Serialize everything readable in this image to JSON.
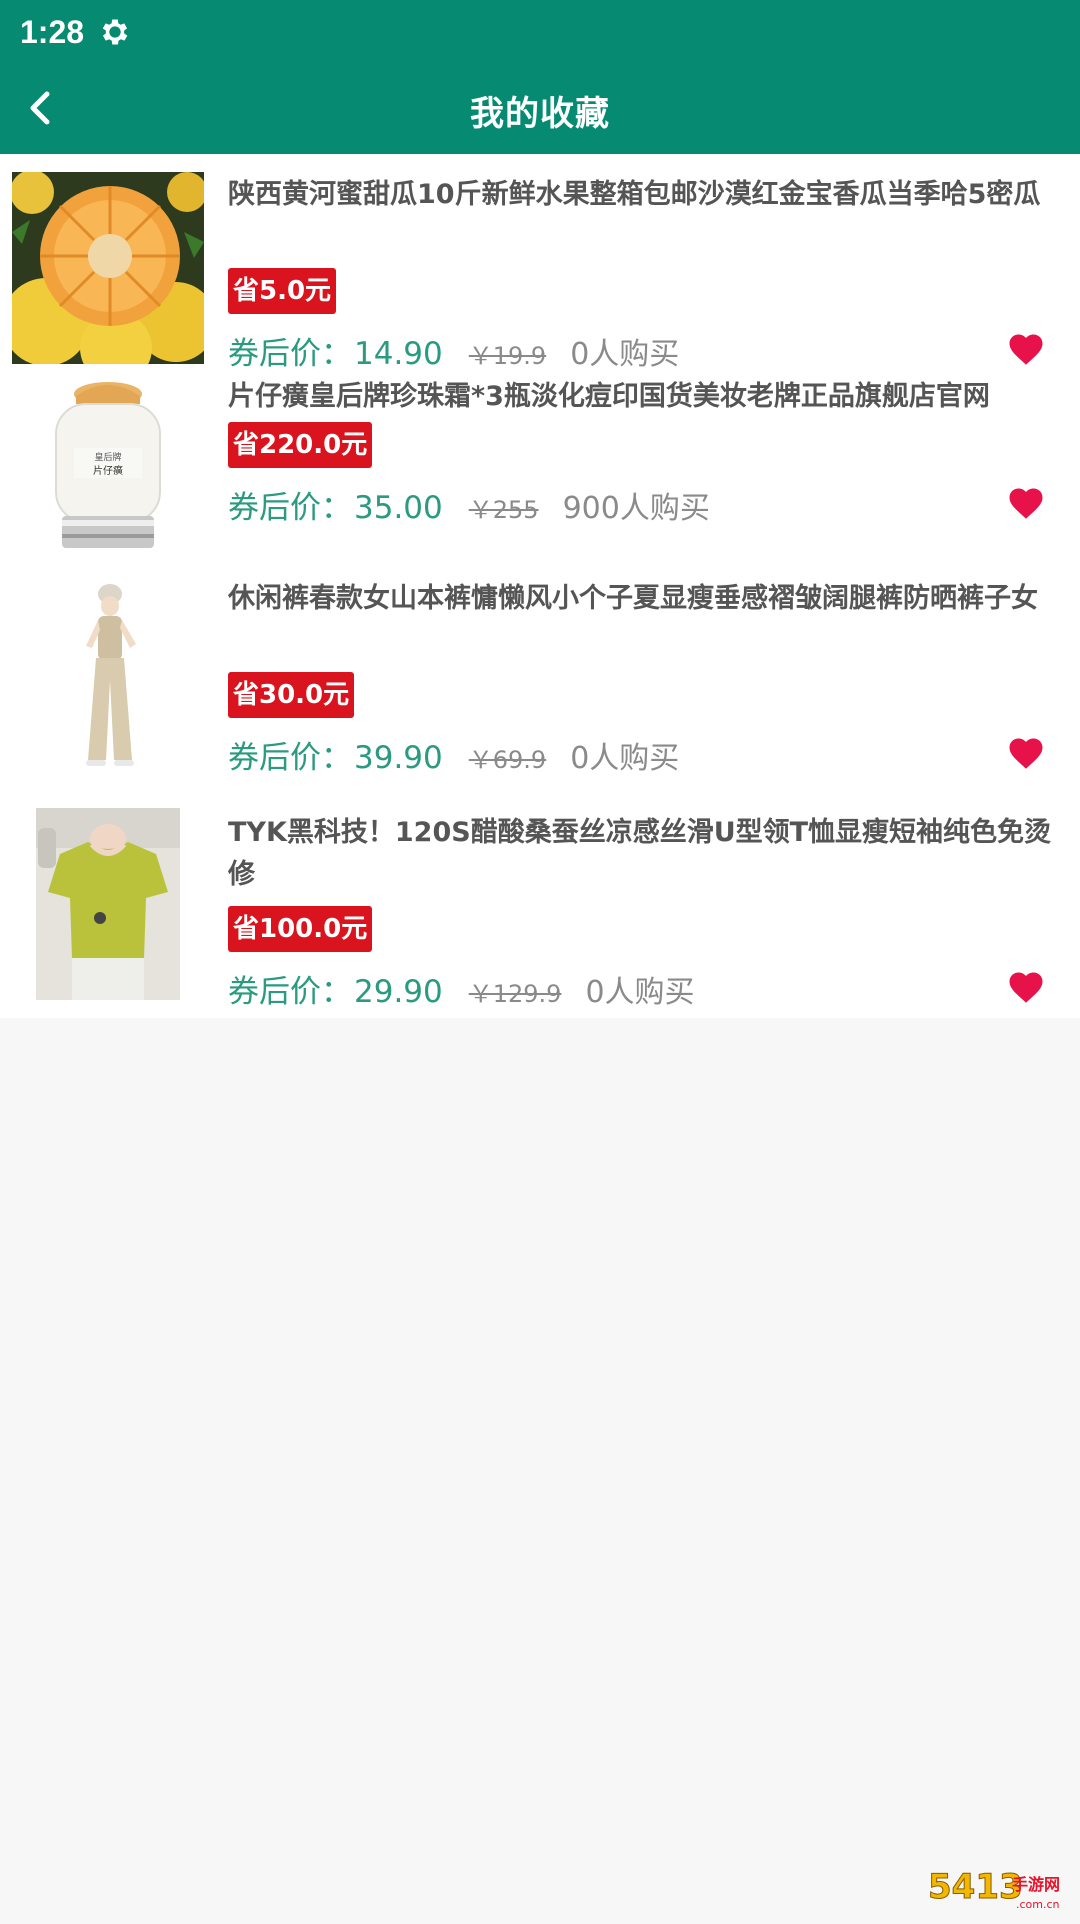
{
  "status_bar": {
    "time": "1:28",
    "settings_icon": "gear-icon"
  },
  "app_bar": {
    "title": "我的收藏",
    "back_icon": "chevron-left-icon",
    "background": "#068a72"
  },
  "colors": {
    "accent": "#068a72",
    "price_green": "#2a9a80",
    "badge_red": "#d9141e",
    "heart_red": "#e8124a"
  },
  "favorites": [
    {
      "title": "陕西黄河蜜甜瓜10斤新鲜水果整箱包邮沙漠红金宝香瓜当季哈5密瓜",
      "save_badge": "省5.0元",
      "price_label": "券后价：",
      "price": "14.90",
      "original_price": "￥19.9",
      "buyers": "0人购买",
      "image_icon": "melon-image",
      "favorited": true
    },
    {
      "title": "片仔癀皇后牌珍珠霜*3瓶淡化痘印国货美妆老牌正品旗舰店官网",
      "save_badge": "省220.0元",
      "price_label": "券后价：",
      "price": "35.00",
      "original_price": "￥255",
      "buyers": "900人购买",
      "image_icon": "cream-jar-image",
      "favorited": true
    },
    {
      "title": "休闲裤春款女山本裤慵懒风小个子夏显瘦垂感褶皱阔腿裤防晒裤子女",
      "save_badge": "省30.0元",
      "price_label": "券后价：",
      "price": "39.90",
      "original_price": "￥69.9",
      "buyers": "0人购买",
      "image_icon": "pants-outfit-image",
      "favorited": true
    },
    {
      "title": "TYK黑科技！120S醋酸桑蚕丝凉感丝滑U型领T恤显瘦短袖纯色免烫修",
      "save_badge": "省100.0元",
      "price_label": "券后价：",
      "price": "29.90",
      "original_price": "￥129.9",
      "buyers": "0人购买",
      "image_icon": "tshirt-image",
      "favorited": true
    }
  ],
  "watermark": {
    "text": "5413手游网",
    "subtext": ".com.cn"
  }
}
